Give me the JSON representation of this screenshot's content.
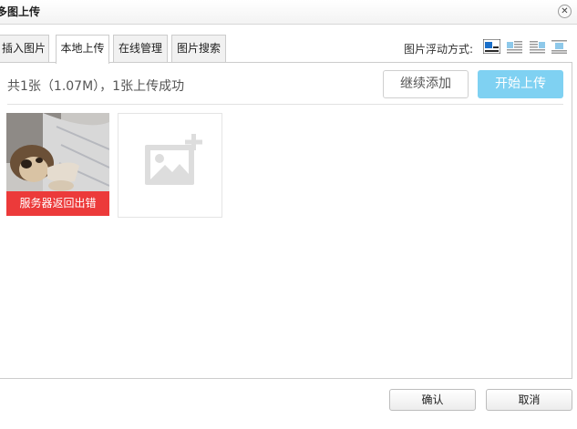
{
  "window": {
    "title": "多图上传",
    "close_symbol": "✕"
  },
  "tabs": [
    {
      "label": "插入图片",
      "active": false
    },
    {
      "label": "本地上传",
      "active": true
    },
    {
      "label": "在线管理",
      "active": false
    },
    {
      "label": "图片搜索",
      "active": false
    }
  ],
  "float_options": {
    "label": "图片浮动方式:",
    "options": [
      "none-icon",
      "left-icon",
      "right-icon",
      "center-icon"
    ],
    "selected_index": 0
  },
  "upload": {
    "status": "共1张（1.07M），1张上传成功",
    "continue_label": "继续添加",
    "start_label": "开始上传",
    "items": [
      {
        "error": "服务器返回出错"
      }
    ]
  },
  "footer": {
    "ok_label": "确认",
    "cancel_label": "取消"
  },
  "colors": {
    "accent": "#7fd1f2",
    "error": "#ec3a3a",
    "icon_blue": "#1a6fc9"
  }
}
